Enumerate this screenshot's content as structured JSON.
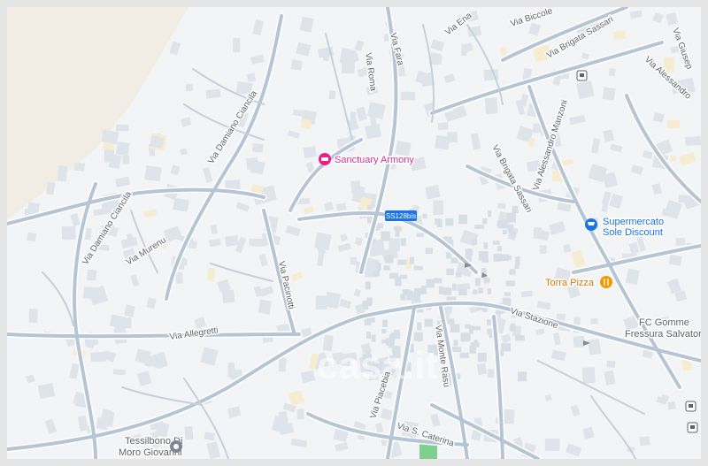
{
  "map": {
    "roads": [
      {
        "name": "Via Damiano Ciancila",
        "id": "road-via-damiano-ciancila-north"
      },
      {
        "name": "Via Damiano Ciancila",
        "id": "road-via-damiano-ciancila-south"
      },
      {
        "name": "Via Murenu",
        "id": "road-via-murenu"
      },
      {
        "name": "Via Pacinotti",
        "id": "road-via-pacinotti"
      },
      {
        "name": "Via Allegretti",
        "id": "road-via-allegretti"
      },
      {
        "name": "Via Roma",
        "id": "road-via-roma"
      },
      {
        "name": "Via Fara",
        "id": "road-via-fara"
      },
      {
        "name": "Via Ena",
        "id": "road-via-ena"
      },
      {
        "name": "Via Biccole",
        "id": "road-via-biccole"
      },
      {
        "name": "Via Brigata Sassari",
        "id": "road-via-brigata-sassari-north"
      },
      {
        "name": "Via Brigata Sassari",
        "id": "road-via-brigata-sassari-south"
      },
      {
        "name": "Via Alessandro Manzoni",
        "id": "road-via-alessandro-manzoni"
      },
      {
        "name": "Via Alessandro",
        "id": "road-via-alessandro"
      },
      {
        "name": "Via Giusep",
        "id": "road-via-giusep"
      },
      {
        "name": "Via Stazione",
        "id": "road-via-stazione"
      },
      {
        "name": "Via Piacebia",
        "id": "road-via-piacebia"
      },
      {
        "name": "Via Monte Rasu",
        "id": "road-via-monte-rasu"
      },
      {
        "name": "Via S. Caterina",
        "id": "road-via-s-caterina"
      }
    ],
    "shield": "SS128bis",
    "pois": [
      {
        "name": "Sanctuary Armony",
        "icon": "hotel-icon",
        "color": "#e91e8c"
      },
      {
        "name": "Supermercato",
        "name2": "Sole Discount",
        "icon": "shopping-cart-icon",
        "color": "#1a73e8"
      },
      {
        "name": "Torra Pizza",
        "icon": "restaurant-icon",
        "color": "#f29900"
      },
      {
        "name": "FC Gomme",
        "name2": "Fressura Salvator",
        "icon": "",
        "color": "#5f6368"
      },
      {
        "name": "Tessilbono Di",
        "name2": "Moro Giovanni",
        "icon": "place-icon",
        "color": "#5f6368"
      }
    ],
    "watermark": "casa.it",
    "colors": {
      "background": "#f3f4f6",
      "road": "#aebfcf",
      "building": "#e1e5eb",
      "sand": "#f1ede5",
      "park": "#7fd08f"
    }
  }
}
